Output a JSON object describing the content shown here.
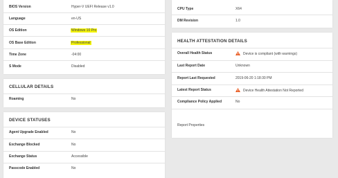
{
  "system": {
    "rows": [
      {
        "label": "BIOS Version",
        "value": "Hyper-V UEFI Release v1.0"
      },
      {
        "label": "Language",
        "value": "en-US"
      },
      {
        "label": "OS Edition",
        "value": "Windows 10 Pro"
      },
      {
        "label": "OS Base Edition",
        "value": "Professional"
      },
      {
        "label": "Time Zone",
        "value": "-04:00"
      },
      {
        "label": "S Mode",
        "value": "Disabled"
      }
    ]
  },
  "cellular": {
    "title": "CELLULAR DETAILS",
    "rows": [
      {
        "label": "Roaming",
        "value": "No"
      }
    ]
  },
  "device_statuses": {
    "title": "DEVICE STATUSES",
    "rows": [
      {
        "label": "Agent Upgrade Enabled",
        "value": "No"
      },
      {
        "label": "Exchange Blocked",
        "value": "No"
      },
      {
        "label": "Exchange Status",
        "value": "Accessible"
      },
      {
        "label": "Passcode Enabled",
        "value": "No"
      }
    ]
  },
  "hardware": {
    "rows": [
      {
        "label": "CPU Type",
        "value": "X64"
      },
      {
        "label": "DM Revision",
        "value": "1.0"
      }
    ]
  },
  "health": {
    "title": "HEALTH ATTESTATION DETAILS",
    "rows": [
      {
        "label": "Overall Health Status",
        "value": "Device is compliant (with warnings)",
        "icon": "warning-icon"
      },
      {
        "label": "Last Report Date",
        "value": "Unknown"
      },
      {
        "label": "Report Last Requested",
        "value": "2019-06-20 1:18:30 PM"
      },
      {
        "label": "Latest Report Status",
        "value": "Device Health Attestation Not Reported",
        "icon": "warning-icon"
      },
      {
        "label": "Compliance Policy Applied",
        "value": "No"
      }
    ],
    "report_properties_label": "Report Properties"
  },
  "colors": {
    "highlight": "#f4f40a",
    "warning": "#e8571c",
    "background": "#e9e9e9"
  }
}
